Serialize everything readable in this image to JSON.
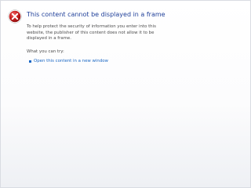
{
  "error": {
    "icon": "error-x-icon",
    "title": "This content cannot be displayed in a frame",
    "description": "To help protect the security of information you enter into this website, the publisher of this content does not allow it to be displayed in a frame."
  },
  "try_section": {
    "label": "What you can try:",
    "options": [
      {
        "icon": "bullet-icon",
        "label": "Open this content in a new window"
      }
    ]
  },
  "colors": {
    "title": "#1f3f99",
    "link": "#1a67c4",
    "icon_red": "#c81e1e",
    "body_text": "#4d4d4d"
  }
}
